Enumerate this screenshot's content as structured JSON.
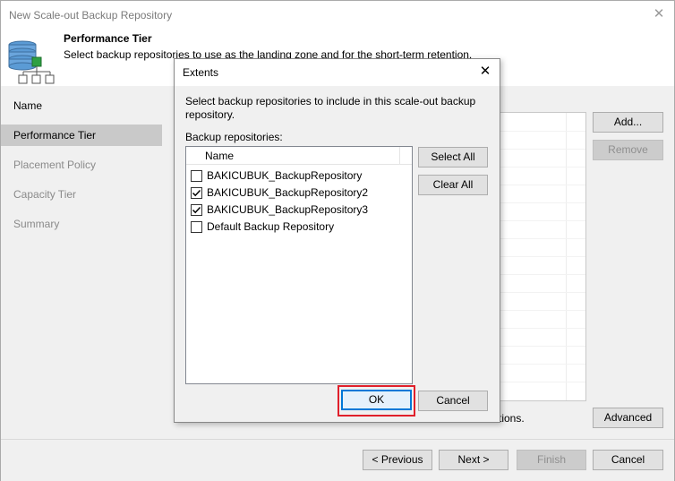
{
  "window": {
    "title": "New Scale-out Backup Repository",
    "close_glyph": "✕"
  },
  "header": {
    "title": "Performance Tier",
    "description": "Select backup repositories to use as the landing zone and for the short-term retention."
  },
  "sidebar": {
    "items": [
      {
        "label": "Name"
      },
      {
        "label": "Performance Tier"
      },
      {
        "label": "Placement Policy"
      },
      {
        "label": "Capacity Tier"
      },
      {
        "label": "Summary"
      }
    ],
    "active_index": 1
  },
  "main": {
    "add_label": "Add...",
    "remove_label": "Remove",
    "advanced_label": "Advanced",
    "partial_text": "tions."
  },
  "dialog": {
    "title": "Extents",
    "close_glyph": "✕",
    "instruction": "Select backup repositories to include in this scale-out backup repository.",
    "list_label": "Backup repositories:",
    "column_name": "Name",
    "items": [
      {
        "label": "BAKICUBUK_BackupRepository",
        "checked": false
      },
      {
        "label": "BAKICUBUK_BackupRepository2",
        "checked": true
      },
      {
        "label": "BAKICUBUK_BackupRepository3",
        "checked": true
      },
      {
        "label": "Default Backup Repository",
        "checked": false
      }
    ],
    "select_all_label": "Select All",
    "clear_all_label": "Clear All",
    "ok_label": "OK",
    "cancel_label": "Cancel"
  },
  "footer": {
    "previous_label": "< Previous",
    "next_label": "Next >",
    "finish_label": "Finish",
    "cancel_label": "Cancel"
  },
  "colors": {
    "highlight_border": "#e0202b",
    "active_sidebar": "#c9c9c9",
    "default_button_border": "#0078d7"
  }
}
